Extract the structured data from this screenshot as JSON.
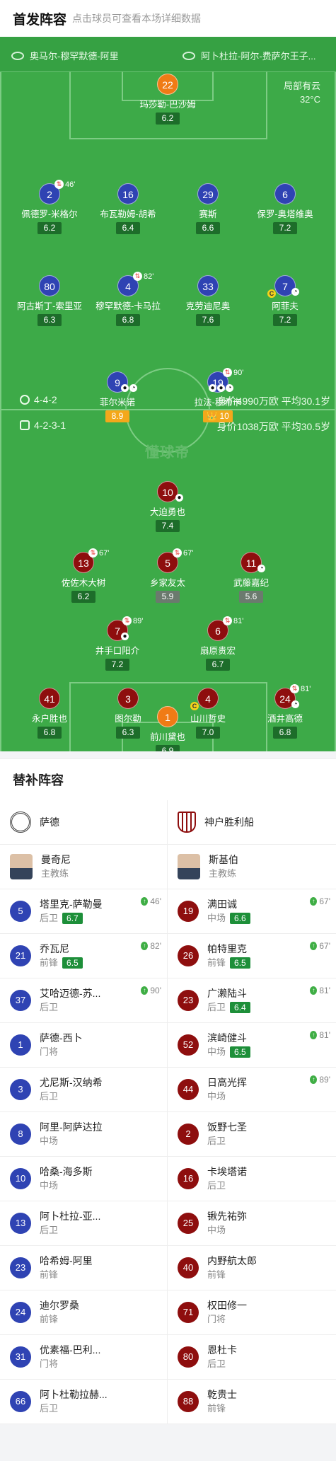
{
  "header": {
    "title": "首发阵容",
    "subtitle": "点击球员可查看本场详细数据"
  },
  "teams": {
    "home": "奥马尔-穆罕默德-阿里",
    "away": "阿卜杜拉-阿尔-费萨尔王子..."
  },
  "weather": {
    "condition": "局部有云",
    "temp": "32°C"
  },
  "watermark": "懂球帝",
  "home_formation": {
    "formation": "4-4-2",
    "value": "身价4990万欧 平均30.1岁"
  },
  "away_formation": {
    "formation": "4-2-3-1",
    "value": "身价1038万欧 平均30.5岁"
  },
  "home_players": [
    {
      "num": "22",
      "name": "玛莎勒-巴沙姆",
      "rating": "6.2"
    },
    {
      "num": "2",
      "name": "佩德罗-米格尔",
      "rating": "6.2",
      "sub": "46'"
    },
    {
      "num": "16",
      "name": "布瓦勒姆-胡希",
      "rating": "6.4"
    },
    {
      "num": "29",
      "name": "赛斯",
      "rating": "6.6"
    },
    {
      "num": "6",
      "name": "保罗-奥塔维奥",
      "rating": "7.2"
    },
    {
      "num": "80",
      "name": "阿古斯丁-索里亚",
      "rating": "6.3"
    },
    {
      "num": "4",
      "name": "穆罕默德-卡马拉",
      "rating": "6.8",
      "sub": "82'"
    },
    {
      "num": "33",
      "name": "克劳迪尼奥",
      "rating": "7.6"
    },
    {
      "num": "7",
      "name": "阿菲夫",
      "rating": "7.2"
    },
    {
      "num": "9",
      "name": "菲尔米诺",
      "rating": "8.9"
    },
    {
      "num": "19",
      "name": "拉法-穆希卡",
      "rating": "10",
      "sub": "90'"
    }
  ],
  "away_players": [
    {
      "num": "10",
      "name": "大迫勇也",
      "rating": "7.4"
    },
    {
      "num": "13",
      "name": "佐佐木大树",
      "rating": "6.2",
      "sub": "67'"
    },
    {
      "num": "5",
      "name": "乡家友太",
      "rating": "5.9",
      "sub": "67'"
    },
    {
      "num": "11",
      "name": "武藤嘉纪",
      "rating": "5.6"
    },
    {
      "num": "7",
      "name": "井手口阳介",
      "rating": "7.2",
      "sub": "89'"
    },
    {
      "num": "6",
      "name": "扇原贵宏",
      "rating": "6.7",
      "sub": "81'"
    },
    {
      "num": "41",
      "name": "永户胜也",
      "rating": "6.8"
    },
    {
      "num": "3",
      "name": "图尔勒",
      "rating": "6.3"
    },
    {
      "num": "4",
      "name": "山川哲史",
      "rating": "7.0"
    },
    {
      "num": "24",
      "name": "酒井高德",
      "rating": "6.8",
      "sub": "81'"
    },
    {
      "num": "1",
      "name": "前川黛也",
      "rating": "6.9"
    }
  ],
  "subs": {
    "title": "替补阵容",
    "home": {
      "team": "萨德",
      "coach": {
        "name": "曼奇尼",
        "role": "主教练"
      },
      "players": [
        {
          "num": "5",
          "name": "塔里克-萨勒曼",
          "pos": "后卫",
          "rating": "6.7",
          "time": "46'"
        },
        {
          "num": "21",
          "name": "乔瓦尼",
          "pos": "前锋",
          "rating": "6.5",
          "time": "82'"
        },
        {
          "num": "37",
          "name": "艾哈迈德-苏...",
          "pos": "后卫",
          "time": "90'"
        },
        {
          "num": "1",
          "name": "萨德-西卜",
          "pos": "门将"
        },
        {
          "num": "3",
          "name": "尤尼斯-汉纳希",
          "pos": "后卫"
        },
        {
          "num": "8",
          "name": "阿里-阿萨达拉",
          "pos": "中场"
        },
        {
          "num": "10",
          "name": "哈桑-海多斯",
          "pos": "中场"
        },
        {
          "num": "13",
          "name": "阿卜杜拉-亚...",
          "pos": "后卫"
        },
        {
          "num": "23",
          "name": "哈希姆-阿里",
          "pos": "前锋"
        },
        {
          "num": "24",
          "name": "迪尔罗桑",
          "pos": "前锋"
        },
        {
          "num": "31",
          "name": "优素福-巴利...",
          "pos": "门将"
        },
        {
          "num": "66",
          "name": "阿卜杜勒拉赫...",
          "pos": "后卫"
        }
      ]
    },
    "away": {
      "team": "神户胜利船",
      "coach": {
        "name": "斯基伯",
        "role": "主教练"
      },
      "players": [
        {
          "num": "19",
          "name": "满田诚",
          "pos": "中场",
          "rating": "6.6",
          "time": "67'"
        },
        {
          "num": "26",
          "name": "帕特里克",
          "pos": "前锋",
          "rating": "6.5",
          "time": "67'"
        },
        {
          "num": "23",
          "name": "广濑陆斗",
          "pos": "后卫",
          "rating": "6.4",
          "time": "81'"
        },
        {
          "num": "52",
          "name": "滨崎健斗",
          "pos": "中场",
          "rating": "6.5",
          "time": "81'"
        },
        {
          "num": "44",
          "name": "日高光挥",
          "pos": "中场",
          "time": "89'"
        },
        {
          "num": "2",
          "name": "饭野七圣",
          "pos": "后卫"
        },
        {
          "num": "16",
          "name": "卡埃塔诺",
          "pos": "后卫"
        },
        {
          "num": "25",
          "name": "锹先祐弥",
          "pos": "中场"
        },
        {
          "num": "40",
          "name": "内野航太郎",
          "pos": "前锋"
        },
        {
          "num": "71",
          "name": "权田修一",
          "pos": "门将"
        },
        {
          "num": "80",
          "name": "恩杜卡",
          "pos": "后卫"
        },
        {
          "num": "88",
          "name": "乾贵士",
          "pos": "前锋"
        }
      ]
    }
  },
  "colors": {
    "home": "#2f43b3",
    "away": "#8e0e0e",
    "keeper": "#f07b15",
    "pitch": "#3daa48"
  }
}
